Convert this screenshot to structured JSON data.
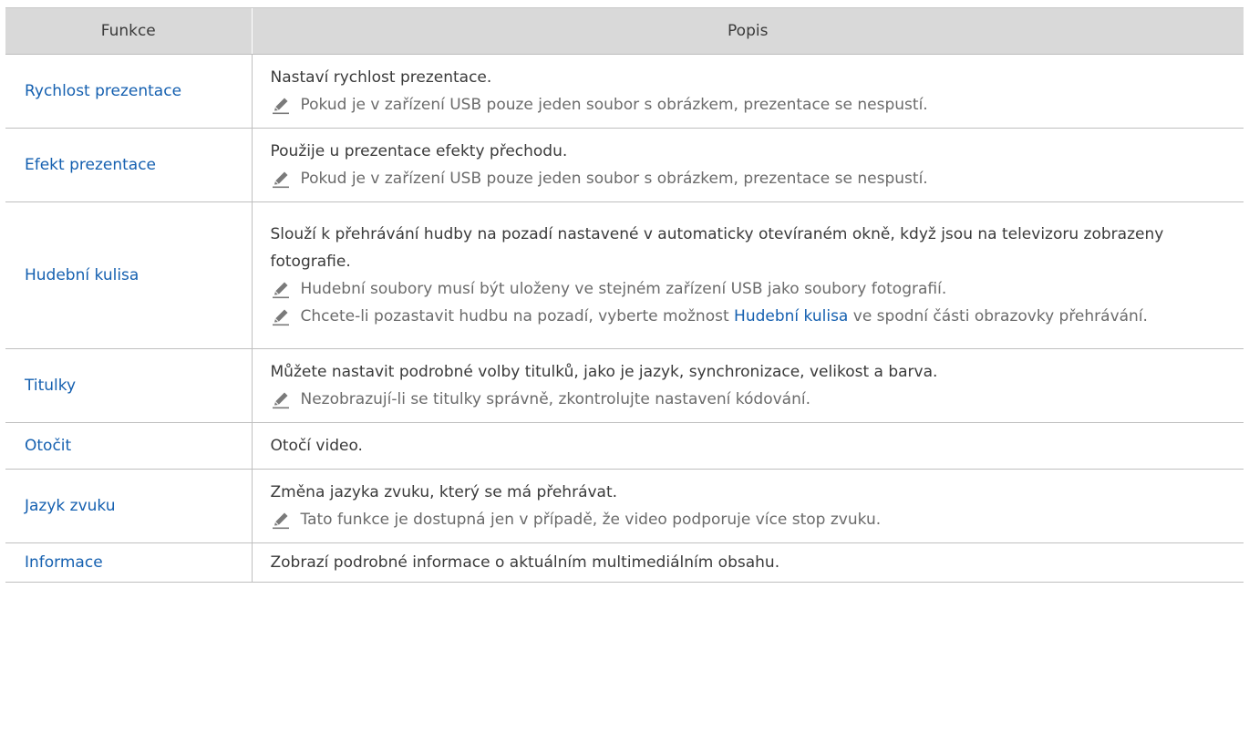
{
  "table": {
    "headers": [
      "Funkce",
      "Popis"
    ],
    "rows": [
      {
        "name": "Rychlost prezentace",
        "desc": "Nastaví rychlost prezentace.",
        "notes": [
          "Pokud je v zařízení USB pouze jeden soubor s obrázkem, prezentace se nespustí."
        ]
      },
      {
        "name": "Efekt prezentace",
        "desc": "Použije u prezentace efekty přechodu.",
        "notes": [
          "Pokud je v zařízení USB pouze jeden soubor s obrázkem, prezentace se nespustí."
        ]
      },
      {
        "name": "Hudební kulisa",
        "desc": "Slouží k přehrávání hudby na pozadí nastavené v automaticky otevíraném okně, když jsou na televizoru zobrazeny fotografie.",
        "notes": [
          "Hudební soubory musí být uloženy ve stejném zařízení USB jako soubory fotografií.",
          {
            "before": "Chcete-li pozastavit hudbu na pozadí, vyberte možnost ",
            "highlight": "Hudební kulisa",
            "after": " ve spodní části obrazovky přehrávání."
          }
        ]
      },
      {
        "name": "Titulky",
        "desc": "Můžete nastavit podrobné volby titulků, jako je jazyk, synchronizace, velikost a barva.",
        "notes": [
          "Nezobrazují-li se titulky správně, zkontrolujte nastavení kódování."
        ]
      },
      {
        "name": "Otočit",
        "desc": "Otočí video.",
        "notes": []
      },
      {
        "name": "Jazyk zvuku",
        "desc": "Změna jazyka zvuku, který se má přehrávat.",
        "notes": [
          "Tato funkce je dostupná jen v případě, že video podporuje více stop zvuku."
        ]
      },
      {
        "name": "Informace",
        "desc": "Zobrazí podrobné informace o aktuálním multimediálním obsahu.",
        "notes": []
      }
    ]
  },
  "icons": {
    "note": "pencil-icon"
  },
  "colors": {
    "header_bg": "#d9d9d9",
    "function_name": "#1560b0",
    "note_text": "#6b6b6b",
    "body_text": "#3a3a3a",
    "rule": "#bfbfbf"
  }
}
